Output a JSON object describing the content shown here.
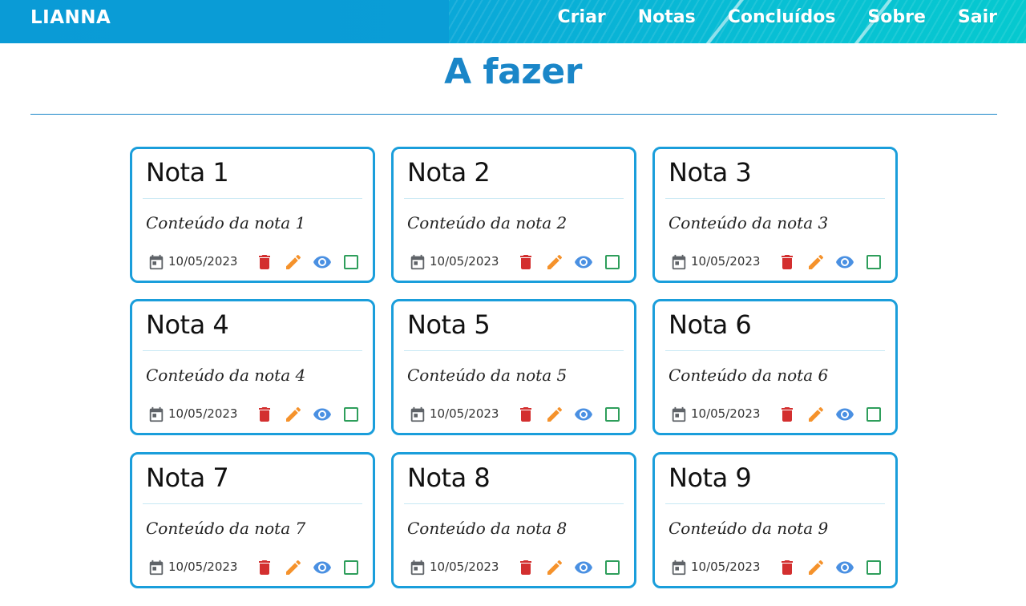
{
  "navbar": {
    "brand": "LIANNA",
    "links": [
      "Criar",
      "Notas",
      "Concluídos",
      "Sobre",
      "Sair"
    ]
  },
  "page": {
    "title": "A fazer"
  },
  "notes": [
    {
      "title": "Nota 1",
      "content": "Conteúdo da nota 1",
      "date": "10/05/2023"
    },
    {
      "title": "Nota 2",
      "content": "Conteúdo da nota 2",
      "date": "10/05/2023"
    },
    {
      "title": "Nota 3",
      "content": "Conteúdo da nota 3",
      "date": "10/05/2023"
    },
    {
      "title": "Nota 4",
      "content": "Conteúdo da nota 4",
      "date": "10/05/2023"
    },
    {
      "title": "Nota 5",
      "content": "Conteúdo da nota 5",
      "date": "10/05/2023"
    },
    {
      "title": "Nota 6",
      "content": "Conteúdo da nota 6",
      "date": "10/05/2023"
    },
    {
      "title": "Nota 7",
      "content": "Conteúdo da nota 7",
      "date": "10/05/2023"
    },
    {
      "title": "Nota 8",
      "content": "Conteúdo da nota 8",
      "date": "10/05/2023"
    },
    {
      "title": "Nota 9",
      "content": "Conteúdo da nota 9",
      "date": "10/05/2023"
    }
  ],
  "icons": {
    "date": "calendar-icon",
    "delete": "trash-icon",
    "edit": "pencil-icon",
    "view": "eye-icon",
    "complete": "checkbox-icon"
  },
  "colors": {
    "accent": "#1a86c8",
    "card_border": "#1a9edb",
    "delete": "#d32f2f",
    "edit": "#f5922b",
    "view": "#4a90e2",
    "complete": "#2e9e5b"
  }
}
